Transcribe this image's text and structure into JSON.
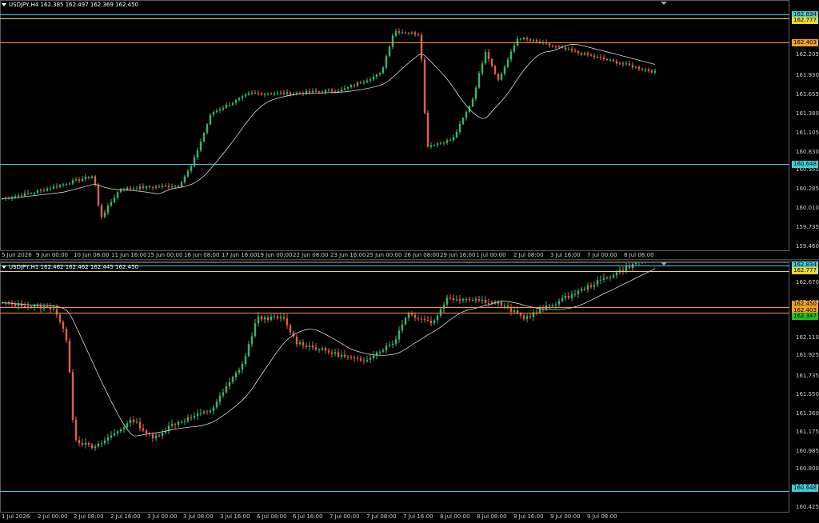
{
  "colors": {
    "background": "#000000",
    "bull": "#3cb371",
    "bear": "#e06050",
    "ma": "#d8d8d8",
    "cyan": "#40d0d8",
    "yellow": "#e8d830",
    "orange": "#f0a020",
    "green": "#20c020"
  },
  "top_chart": {
    "header": "USDJPY,H4  162.385 162.497 162.369 162.450",
    "price_ticks": [
      "162.205",
      "161.930",
      "161.655",
      "161.380",
      "161.105",
      "160.830",
      "160.555",
      "160.285",
      "160.010",
      "159.735",
      "159.460"
    ],
    "time_ticks": [
      "5 Jun 2026",
      "9 Jun 00:00",
      "10 Jun 08:00",
      "11 Jun 16:00",
      "15 Jun 00:00",
      "16 Jun 08:00",
      "17 Jun 16:00",
      "19 Jun 00:00",
      "22 Jun 08:00",
      "23 Jun 16:00",
      "25 Jun 00:00",
      "26 Jun 08:00",
      "29 Jun 16:00",
      "1 Jul 00:00",
      "2 Jul 08:00",
      "3 Jul 16:00",
      "7 Jul 00:00",
      "8 Jul 08:00"
    ],
    "level_labels": [
      {
        "text": "162.834",
        "kind": "cyan"
      },
      {
        "text": "162.777",
        "kind": "yellow"
      },
      {
        "text": "162.403",
        "kind": "orange"
      },
      {
        "text": "160.648",
        "kind": "cyan"
      }
    ],
    "price_min": 159.4,
    "price_max": 162.95
  },
  "bottom_chart": {
    "header": "USDJPY,H1  162.462 162.462 162.445 162.450",
    "price_ticks": [
      "162.670",
      "162.480",
      "162.295",
      "162.110",
      "161.925",
      "161.735",
      "161.550",
      "161.360",
      "161.175",
      "160.985",
      "160.800",
      "160.610",
      "160.425"
    ],
    "time_ticks": [
      "1 Jul 2026",
      "2 Jul 00:00",
      "2 Jul 08:00",
      "2 Jul 16:00",
      "3 Jul 00:00",
      "3 Jul 08:00",
      "3 Jul 16:00",
      "6 Jul 08:00",
      "6 Jul 16:00",
      "7 Jul 00:00",
      "7 Jul 08:00",
      "7 Jul 16:00",
      "8 Jul 00:00",
      "8 Jul 08:00",
      "8 Jul 16:00",
      "9 Jul 00:00",
      "9 Jul 08:00"
    ],
    "level_labels": [
      {
        "text": "162.834",
        "kind": "cyan"
      },
      {
        "text": "162.777",
        "kind": "yellow"
      },
      {
        "text": "162.450",
        "kind": "orange"
      },
      {
        "text": "162.403",
        "kind": "orange"
      },
      {
        "text": "162.347",
        "kind": "green"
      },
      {
        "text": "160.648",
        "kind": "cyan"
      }
    ],
    "price_min": 160.38,
    "price_max": 162.86
  }
}
